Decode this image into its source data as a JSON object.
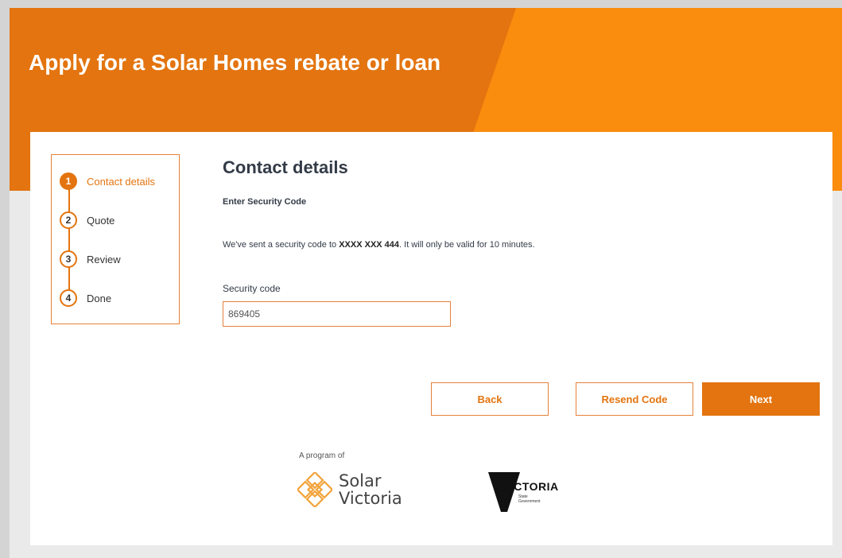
{
  "hero": {
    "title": "Apply for a Solar Homes rebate or loan",
    "colors": {
      "primary": "#e3740f",
      "secondary": "#fa8c0e"
    }
  },
  "stepper": {
    "steps": [
      {
        "number": "1",
        "label": "Contact details",
        "active": true
      },
      {
        "number": "2",
        "label": "Quote",
        "active": false
      },
      {
        "number": "3",
        "label": "Review",
        "active": false
      },
      {
        "number": "4",
        "label": "Done",
        "active": false
      }
    ]
  },
  "main": {
    "title": "Contact details",
    "subheading": "Enter Security Code",
    "info_prefix": "We've sent a security code to ",
    "masked_phone": "XXXX XXX 444",
    "info_suffix": ". It will only be valid for 10 minutes.",
    "field_label": "Security code",
    "code_value": "869405"
  },
  "buttons": {
    "back": "Back",
    "resend": "Resend Code",
    "next": "Next"
  },
  "footer": {
    "program_of": "A program of",
    "solar_victoria_line1": "Solar",
    "solar_victoria_line2": "Victoria",
    "victoria_word": "VICTORIA",
    "victoria_sub": "State Government"
  }
}
